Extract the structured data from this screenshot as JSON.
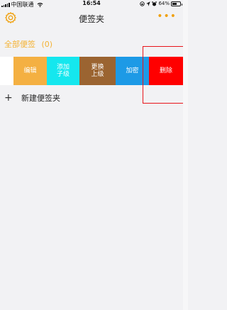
{
  "status_bar": {
    "carrier": "中国联通",
    "time": "16:54",
    "battery_percent": "64%",
    "battery_level": 0.64
  },
  "navbar": {
    "title": "便签夹",
    "more_label": "•••"
  },
  "all_notes": {
    "label": "全部便签",
    "count": "(0)"
  },
  "row_actions": [
    {
      "line1": "编辑",
      "line2": ""
    },
    {
      "line1": "添加",
      "line2": "子级"
    },
    {
      "line1": "更换",
      "line2": "上级"
    },
    {
      "line1": "加密",
      "line2": ""
    },
    {
      "line1": "删除",
      "line2": ""
    }
  ],
  "new_folder": {
    "label": "新建便签夹"
  },
  "colors": {
    "accent": "#f0a10f",
    "edit": "#f4b042",
    "add_child": "#15e7ee",
    "change_parent": "#9b6431",
    "encrypt": "#1d9ae6",
    "delete": "#ff0000",
    "highlight": "#e8141a"
  }
}
